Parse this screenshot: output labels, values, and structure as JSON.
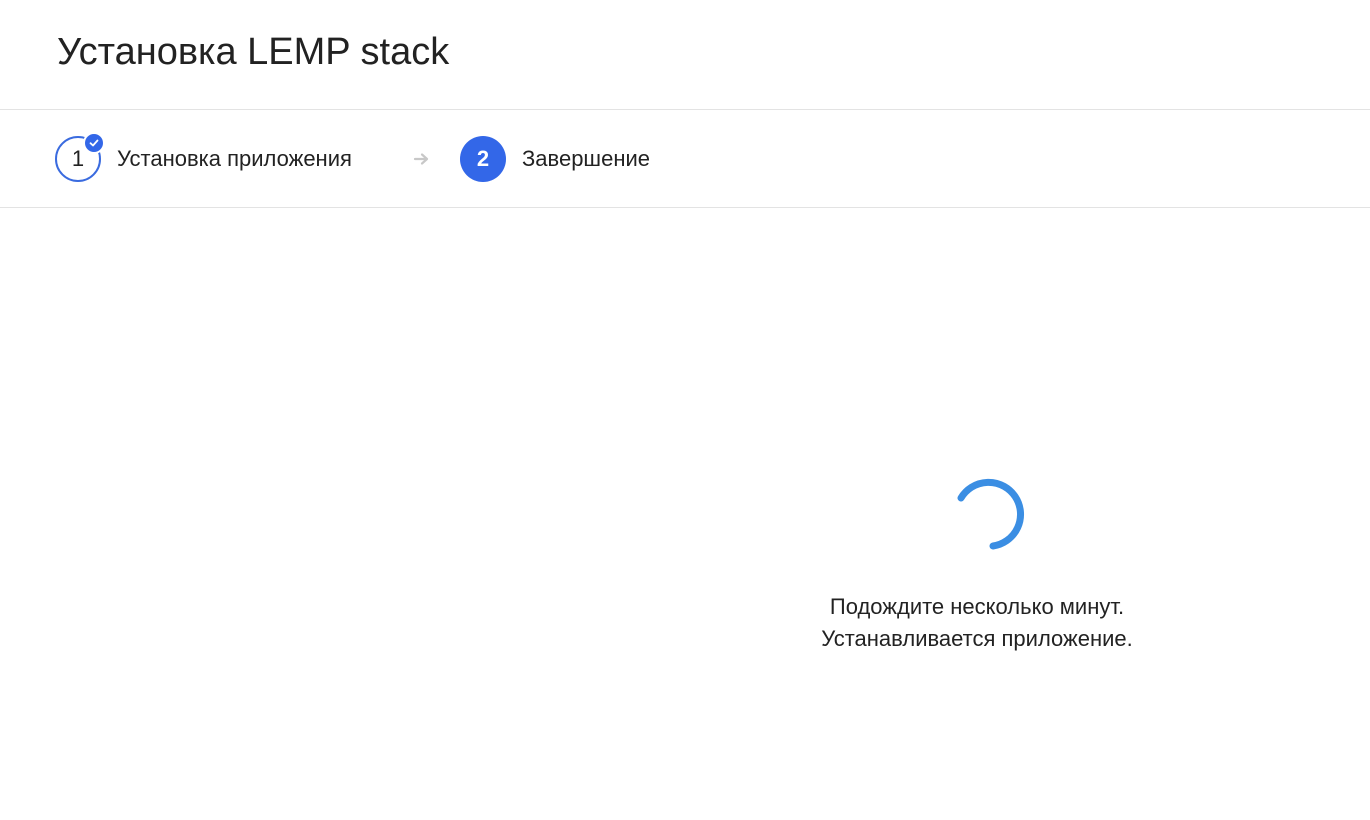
{
  "page": {
    "title": "Установка LEMP stack"
  },
  "stepper": {
    "steps": [
      {
        "number": "1",
        "label": "Установка приложения",
        "state": "done",
        "icon": "check-icon"
      },
      {
        "number": "2",
        "label": "Завершение",
        "state": "active"
      }
    ],
    "separator_icon": "arrow-right-icon"
  },
  "loader": {
    "spinner_icon": "spinner-icon",
    "line1": "Подождите несколько минут.",
    "line2": "Устанавливается приложение."
  },
  "colors": {
    "accent": "#3367e8",
    "spinner": "#3b8ee3",
    "divider": "#e3e3e3",
    "arrow": "#c8c8c8"
  }
}
